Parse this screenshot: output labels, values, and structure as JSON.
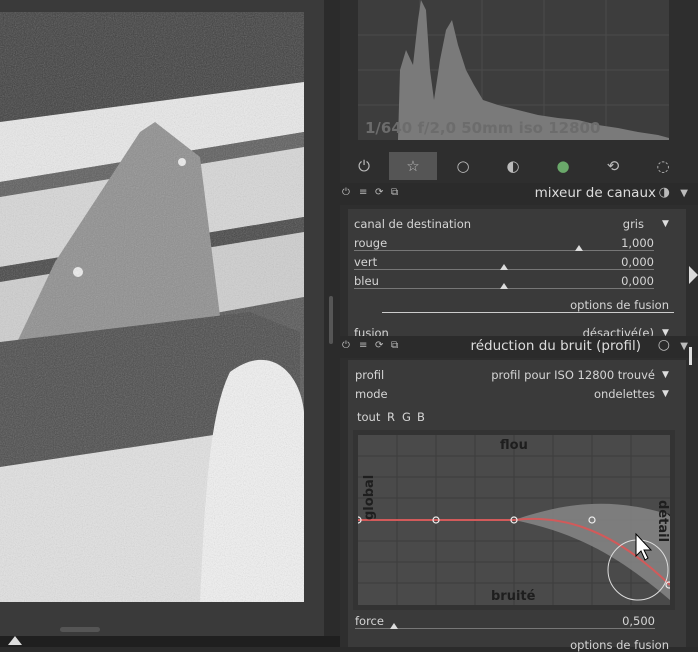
{
  "histogram": {
    "info": "1/640 f/2,0 50mm iso 12800"
  },
  "tabs": [
    {
      "name": "power",
      "glyph": "⏻"
    },
    {
      "name": "favorites",
      "glyph": "☆"
    },
    {
      "name": "base",
      "glyph": "○"
    },
    {
      "name": "tone",
      "glyph": "◐"
    },
    {
      "name": "color",
      "glyph": "●"
    },
    {
      "name": "correct",
      "glyph": "⟲"
    },
    {
      "name": "effect",
      "glyph": "◌"
    }
  ],
  "module1": {
    "title": "mixeur de canaux",
    "dest_label": "canal de destination",
    "dest_value": "gris",
    "sliders": [
      {
        "label": "rouge",
        "value": "1,000",
        "level": 0.75
      },
      {
        "label": "vert",
        "value": "0,000",
        "level": 0.5
      },
      {
        "label": "bleu",
        "value": "0,000",
        "level": 0.5
      }
    ],
    "blend_options": "options de fusion",
    "fusion_label": "fusion",
    "fusion_value": "désactivé(e)"
  },
  "module2": {
    "title": "réduction du bruit (profil)",
    "profile_label": "profil",
    "profile_value": "profil pour ISO 12800 trouvé",
    "mode_label": "mode",
    "mode_value": "ondelettes",
    "channels": [
      "tout",
      "R",
      "G",
      "B"
    ],
    "graph": {
      "top": "flou",
      "bottom": "bruité",
      "left": "global",
      "right": "détail"
    },
    "force_label": "force",
    "force_value": "0,500",
    "force_level": 0.13,
    "blend_options": "options de fusion"
  },
  "colors": {
    "curve": "#d25a5a",
    "panel_bg": "#2e2e2e",
    "module_bg": "#3a3a3a"
  }
}
